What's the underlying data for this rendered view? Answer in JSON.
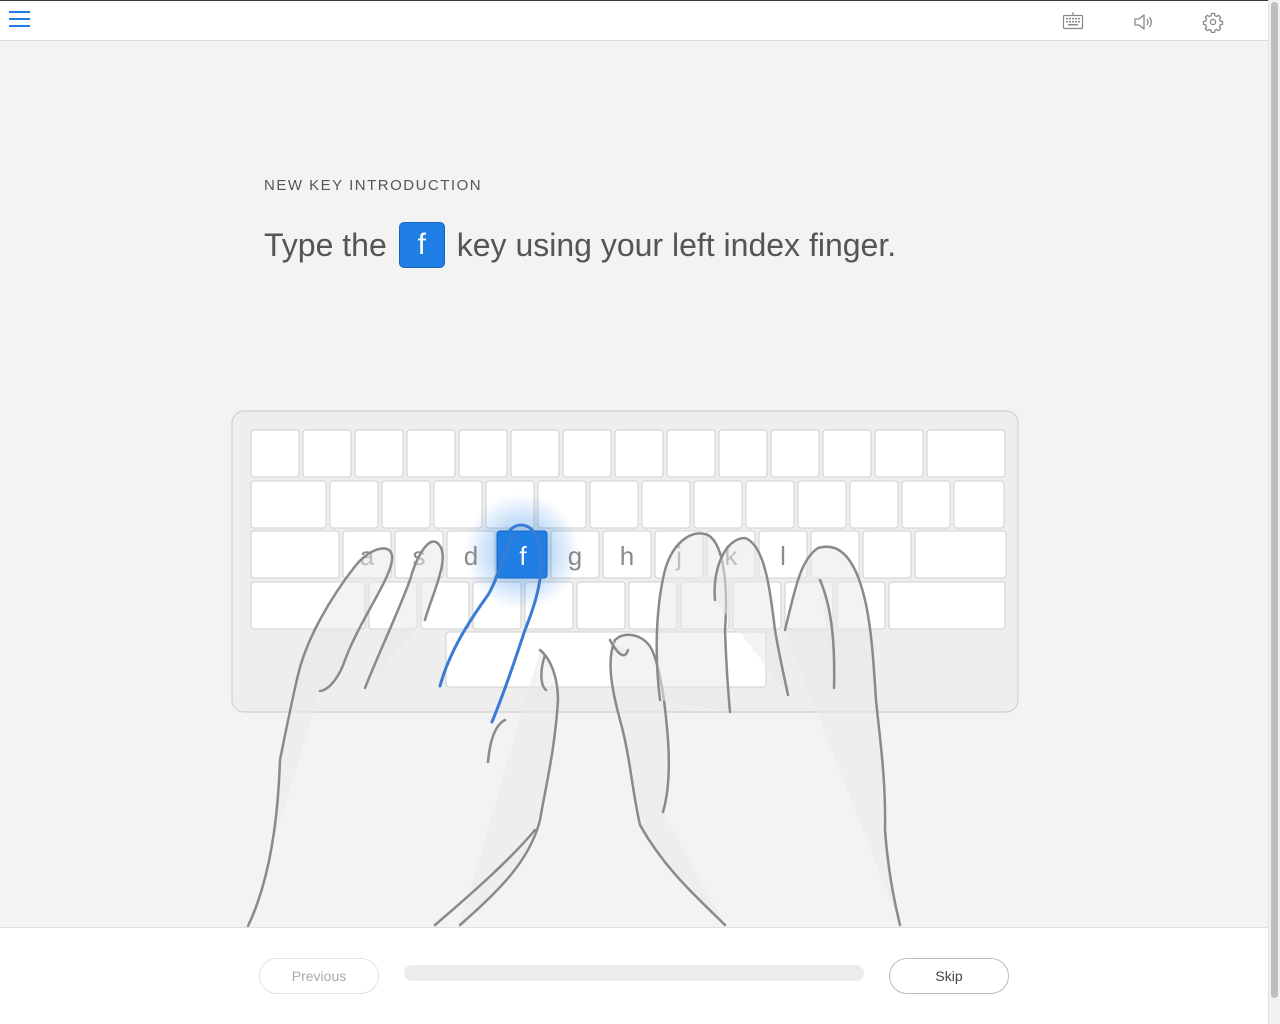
{
  "header": {
    "menu_icon": "hamburger-icon",
    "actions": [
      {
        "icon": "keyboard-icon"
      },
      {
        "icon": "speaker-icon"
      },
      {
        "icon": "gear-icon"
      }
    ]
  },
  "lesson": {
    "kicker": "NEW KEY INTRODUCTION",
    "before_key": "Type the",
    "key": "f",
    "after_key": "key using your left index finger."
  },
  "keyboard": {
    "home_row_labels": [
      "a",
      "s",
      "d",
      "f",
      "g",
      "h",
      "j",
      "k",
      "l"
    ],
    "highlighted_key": "f"
  },
  "footer": {
    "previous_label": "Previous",
    "skip_label": "Skip",
    "progress": 0
  },
  "colors": {
    "accent": "#1f7fe5",
    "background": "#f3f3f3",
    "key_fill": "#ffffff",
    "keyboard_fill": "#eeeeee",
    "hand_stroke": "#8a8a8a"
  }
}
